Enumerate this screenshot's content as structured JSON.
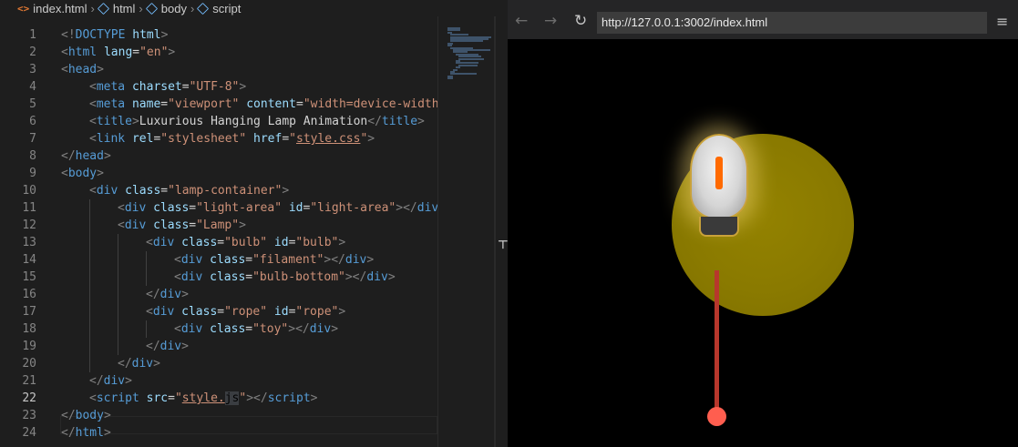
{
  "breadcrumb": {
    "items": [
      "index.html",
      "html",
      "body",
      "script"
    ],
    "separator": "›"
  },
  "browser": {
    "url": "http://127.0.0.1:3002/index.html",
    "back_icon": "←",
    "forward_icon": "→",
    "reload_icon": "↻",
    "menu_icon": "≡"
  },
  "editor": {
    "active_line": 22,
    "lines": [
      {
        "n": "1",
        "indent": 0,
        "tokens": [
          {
            "t": "punc",
            "v": "<!"
          },
          {
            "t": "tag",
            "v": "DOCTYPE"
          },
          {
            "t": "text",
            "v": " "
          },
          {
            "t": "attr",
            "v": "html"
          },
          {
            "t": "punc",
            "v": ">"
          }
        ]
      },
      {
        "n": "2",
        "indent": 0,
        "tokens": [
          {
            "t": "punc",
            "v": "<"
          },
          {
            "t": "tag",
            "v": "html"
          },
          {
            "t": "text",
            "v": " "
          },
          {
            "t": "attr",
            "v": "lang"
          },
          {
            "t": "text",
            "v": "="
          },
          {
            "t": "str",
            "v": "\"en\""
          },
          {
            "t": "punc",
            "v": ">"
          }
        ]
      },
      {
        "n": "3",
        "indent": 0,
        "tokens": [
          {
            "t": "punc",
            "v": "<"
          },
          {
            "t": "tag",
            "v": "head"
          },
          {
            "t": "punc",
            "v": ">"
          }
        ]
      },
      {
        "n": "4",
        "indent": 1,
        "tokens": [
          {
            "t": "punc",
            "v": "<"
          },
          {
            "t": "tag",
            "v": "meta"
          },
          {
            "t": "text",
            "v": " "
          },
          {
            "t": "attr",
            "v": "charset"
          },
          {
            "t": "text",
            "v": "="
          },
          {
            "t": "str",
            "v": "\"UTF-8\""
          },
          {
            "t": "punc",
            "v": ">"
          }
        ]
      },
      {
        "n": "5",
        "indent": 1,
        "tokens": [
          {
            "t": "punc",
            "v": "<"
          },
          {
            "t": "tag",
            "v": "meta"
          },
          {
            "t": "text",
            "v": " "
          },
          {
            "t": "attr",
            "v": "name"
          },
          {
            "t": "text",
            "v": "="
          },
          {
            "t": "str",
            "v": "\"viewport\""
          },
          {
            "t": "text",
            "v": " "
          },
          {
            "t": "attr",
            "v": "content"
          },
          {
            "t": "text",
            "v": "="
          },
          {
            "t": "str",
            "v": "\"width=device-width,"
          }
        ]
      },
      {
        "n": "6",
        "indent": 1,
        "tokens": [
          {
            "t": "punc",
            "v": "<"
          },
          {
            "t": "tag",
            "v": "title"
          },
          {
            "t": "punc",
            "v": ">"
          },
          {
            "t": "text",
            "v": "Luxurious Hanging Lamp Animation"
          },
          {
            "t": "punc",
            "v": "</"
          },
          {
            "t": "tag",
            "v": "title"
          },
          {
            "t": "punc",
            "v": ">"
          }
        ]
      },
      {
        "n": "7",
        "indent": 1,
        "tokens": [
          {
            "t": "punc",
            "v": "<"
          },
          {
            "t": "tag",
            "v": "link"
          },
          {
            "t": "text",
            "v": " "
          },
          {
            "t": "attr",
            "v": "rel"
          },
          {
            "t": "text",
            "v": "="
          },
          {
            "t": "str",
            "v": "\"stylesheet\""
          },
          {
            "t": "text",
            "v": " "
          },
          {
            "t": "attr",
            "v": "href"
          },
          {
            "t": "text",
            "v": "="
          },
          {
            "t": "str",
            "v": "\""
          },
          {
            "t": "link",
            "v": "style.css"
          },
          {
            "t": "str",
            "v": "\""
          },
          {
            "t": "punc",
            "v": ">"
          }
        ]
      },
      {
        "n": "8",
        "indent": 0,
        "tokens": [
          {
            "t": "punc",
            "v": "</"
          },
          {
            "t": "tag",
            "v": "head"
          },
          {
            "t": "punc",
            "v": ">"
          }
        ]
      },
      {
        "n": "9",
        "indent": 0,
        "tokens": [
          {
            "t": "punc",
            "v": "<"
          },
          {
            "t": "tag",
            "v": "body"
          },
          {
            "t": "punc",
            "v": ">"
          }
        ]
      },
      {
        "n": "10",
        "indent": 1,
        "tokens": [
          {
            "t": "punc",
            "v": "<"
          },
          {
            "t": "tag",
            "v": "div"
          },
          {
            "t": "text",
            "v": " "
          },
          {
            "t": "attr",
            "v": "class"
          },
          {
            "t": "text",
            "v": "="
          },
          {
            "t": "str",
            "v": "\"lamp-container\""
          },
          {
            "t": "punc",
            "v": ">"
          }
        ]
      },
      {
        "n": "11",
        "indent": 2,
        "tokens": [
          {
            "t": "punc",
            "v": "<"
          },
          {
            "t": "tag",
            "v": "div"
          },
          {
            "t": "text",
            "v": " "
          },
          {
            "t": "attr",
            "v": "class"
          },
          {
            "t": "text",
            "v": "="
          },
          {
            "t": "str",
            "v": "\"light-area\""
          },
          {
            "t": "text",
            "v": " "
          },
          {
            "t": "attr",
            "v": "id"
          },
          {
            "t": "text",
            "v": "="
          },
          {
            "t": "str",
            "v": "\"light-area\""
          },
          {
            "t": "punc",
            "v": "></"
          },
          {
            "t": "tag",
            "v": "div"
          },
          {
            "t": "punc",
            "v": ">"
          }
        ]
      },
      {
        "n": "12",
        "indent": 2,
        "tokens": [
          {
            "t": "punc",
            "v": "<"
          },
          {
            "t": "tag",
            "v": "div"
          },
          {
            "t": "text",
            "v": " "
          },
          {
            "t": "attr",
            "v": "class"
          },
          {
            "t": "text",
            "v": "="
          },
          {
            "t": "str",
            "v": "\"Lamp\""
          },
          {
            "t": "punc",
            "v": ">"
          }
        ]
      },
      {
        "n": "13",
        "indent": 3,
        "tokens": [
          {
            "t": "punc",
            "v": "<"
          },
          {
            "t": "tag",
            "v": "div"
          },
          {
            "t": "text",
            "v": " "
          },
          {
            "t": "attr",
            "v": "class"
          },
          {
            "t": "text",
            "v": "="
          },
          {
            "t": "str",
            "v": "\"bulb\""
          },
          {
            "t": "text",
            "v": " "
          },
          {
            "t": "attr",
            "v": "id"
          },
          {
            "t": "text",
            "v": "="
          },
          {
            "t": "str",
            "v": "\"bulb\""
          },
          {
            "t": "punc",
            "v": ">"
          }
        ]
      },
      {
        "n": "14",
        "indent": 4,
        "tokens": [
          {
            "t": "punc",
            "v": "<"
          },
          {
            "t": "tag",
            "v": "div"
          },
          {
            "t": "text",
            "v": " "
          },
          {
            "t": "attr",
            "v": "class"
          },
          {
            "t": "text",
            "v": "="
          },
          {
            "t": "str",
            "v": "\"filament\""
          },
          {
            "t": "punc",
            "v": "></"
          },
          {
            "t": "tag",
            "v": "div"
          },
          {
            "t": "punc",
            "v": ">"
          }
        ]
      },
      {
        "n": "15",
        "indent": 4,
        "tokens": [
          {
            "t": "punc",
            "v": "<"
          },
          {
            "t": "tag",
            "v": "div"
          },
          {
            "t": "text",
            "v": " "
          },
          {
            "t": "attr",
            "v": "class"
          },
          {
            "t": "text",
            "v": "="
          },
          {
            "t": "str",
            "v": "\"bulb-bottom\""
          },
          {
            "t": "punc",
            "v": "></"
          },
          {
            "t": "tag",
            "v": "div"
          },
          {
            "t": "punc",
            "v": ">"
          }
        ]
      },
      {
        "n": "16",
        "indent": 3,
        "tokens": [
          {
            "t": "punc",
            "v": "</"
          },
          {
            "t": "tag",
            "v": "div"
          },
          {
            "t": "punc",
            "v": ">"
          }
        ]
      },
      {
        "n": "17",
        "indent": 3,
        "tokens": [
          {
            "t": "punc",
            "v": "<"
          },
          {
            "t": "tag",
            "v": "div"
          },
          {
            "t": "text",
            "v": " "
          },
          {
            "t": "attr",
            "v": "class"
          },
          {
            "t": "text",
            "v": "="
          },
          {
            "t": "str",
            "v": "\"rope\""
          },
          {
            "t": "text",
            "v": " "
          },
          {
            "t": "attr",
            "v": "id"
          },
          {
            "t": "text",
            "v": "="
          },
          {
            "t": "str",
            "v": "\"rope\""
          },
          {
            "t": "punc",
            "v": ">"
          }
        ]
      },
      {
        "n": "18",
        "indent": 4,
        "tokens": [
          {
            "t": "punc",
            "v": "<"
          },
          {
            "t": "tag",
            "v": "div"
          },
          {
            "t": "text",
            "v": " "
          },
          {
            "t": "attr",
            "v": "class"
          },
          {
            "t": "text",
            "v": "="
          },
          {
            "t": "str",
            "v": "\"toy\""
          },
          {
            "t": "punc",
            "v": "></"
          },
          {
            "t": "tag",
            "v": "div"
          },
          {
            "t": "punc",
            "v": ">"
          }
        ]
      },
      {
        "n": "19",
        "indent": 3,
        "tokens": [
          {
            "t": "punc",
            "v": "</"
          },
          {
            "t": "tag",
            "v": "div"
          },
          {
            "t": "punc",
            "v": ">"
          }
        ]
      },
      {
        "n": "20",
        "indent": 2,
        "tokens": [
          {
            "t": "punc",
            "v": "</"
          },
          {
            "t": "tag",
            "v": "div"
          },
          {
            "t": "punc",
            "v": ">"
          }
        ]
      },
      {
        "n": "21",
        "indent": 1,
        "tokens": [
          {
            "t": "punc",
            "v": "</"
          },
          {
            "t": "tag",
            "v": "div"
          },
          {
            "t": "punc",
            "v": ">"
          }
        ]
      },
      {
        "n": "22",
        "indent": 1,
        "tokens": [
          {
            "t": "punc",
            "v": "<"
          },
          {
            "t": "tag",
            "v": "script"
          },
          {
            "t": "text",
            "v": " "
          },
          {
            "t": "attr",
            "v": "src"
          },
          {
            "t": "text",
            "v": "="
          },
          {
            "t": "str",
            "v": "\""
          },
          {
            "t": "link",
            "v": "style."
          },
          {
            "t": "sel",
            "v": "js"
          },
          {
            "t": "str",
            "v": "\""
          },
          {
            "t": "punc",
            "v": "></"
          },
          {
            "t": "tag",
            "v": "script"
          },
          {
            "t": "punc",
            "v": ">"
          }
        ]
      },
      {
        "n": "23",
        "indent": 0,
        "tokens": [
          {
            "t": "punc",
            "v": "</"
          },
          {
            "t": "tag",
            "v": "body"
          },
          {
            "t": "punc",
            "v": ">"
          }
        ]
      },
      {
        "n": "24",
        "indent": 0,
        "tokens": [
          {
            "t": "punc",
            "v": "</"
          },
          {
            "t": "tag",
            "v": "html"
          },
          {
            "t": "punc",
            "v": ">"
          }
        ]
      }
    ]
  },
  "colors": {
    "editor_bg": "#1e1e1e",
    "tag": "#569cd6",
    "attr": "#9cdcfe",
    "string": "#ce9178",
    "light_area": "#8a7a00",
    "filament": "#ff6a00",
    "rope": "#b7372c",
    "toy": "#ff5e4f"
  }
}
